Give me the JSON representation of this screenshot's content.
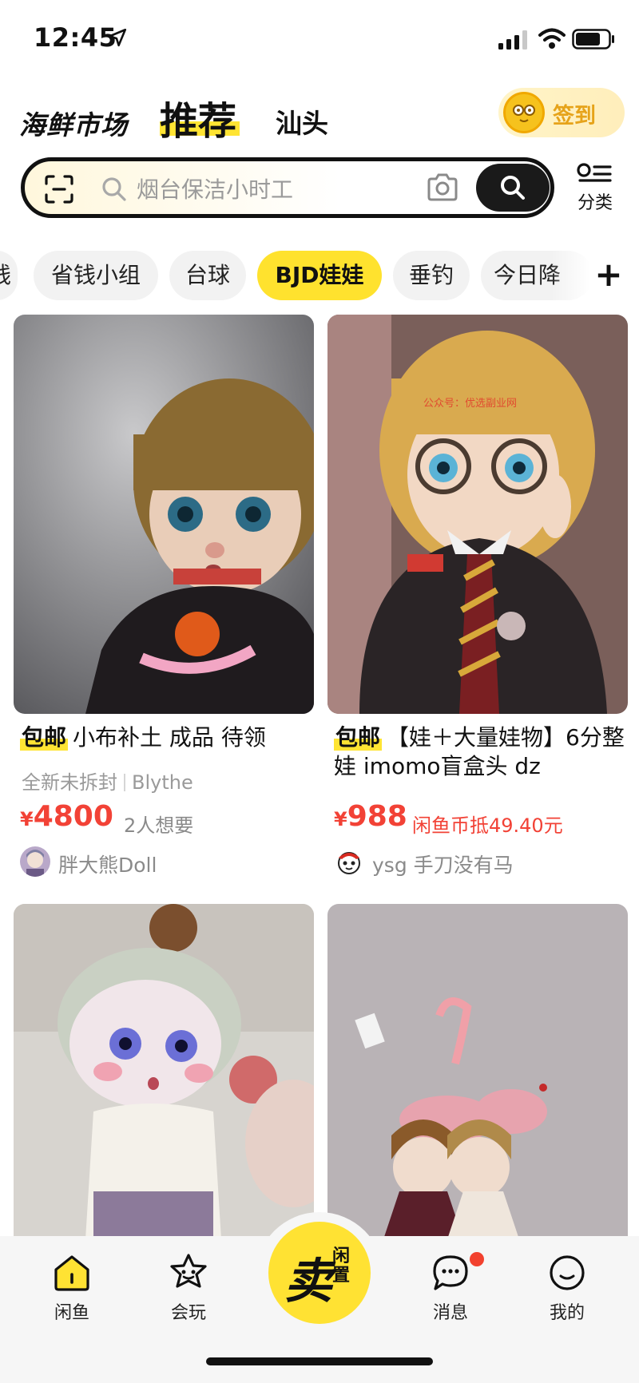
{
  "status_bar": {
    "time": "12:45"
  },
  "header": {
    "logo": "海鲜市场",
    "tab_active": "推荐",
    "tab_city": "汕头",
    "checkin_label": "签到"
  },
  "search": {
    "placeholder": "烟台保洁小时工",
    "category_label": "分类"
  },
  "chips": [
    {
      "label": "钱"
    },
    {
      "label": "省钱小组"
    },
    {
      "label": "台球"
    },
    {
      "label": "BJD娃娃",
      "active": true
    },
    {
      "label": "垂钓"
    },
    {
      "label": "今日降"
    }
  ],
  "chips_add": "+",
  "feed": [
    {
      "tag": "包邮",
      "title": "小布补土 成品 待领",
      "sub_condition": "全新未拆封",
      "sub_brand": "Blythe",
      "currency": "¥",
      "price": "4800",
      "extra": "2人想要",
      "seller": "胖大熊Doll"
    },
    {
      "tag": "包邮",
      "title": "【娃＋大量娃物】6分整娃 imomo盲盒头 dz",
      "currency": "¥",
      "price": "988",
      "extra": "闲鱼币抵49.40元",
      "seller": "ysg 手刀没有马",
      "watermark": "公众号：优选副业网"
    }
  ],
  "bottom_nav": {
    "items": [
      {
        "label": "闲鱼"
      },
      {
        "label": "会玩"
      },
      {
        "label": "消息"
      },
      {
        "label": "我的"
      }
    ],
    "sell_main": "卖",
    "sell_sub": "闲置"
  },
  "colors": {
    "accent": "#ffe233",
    "price": "#f24236",
    "dark": "#111111"
  },
  "icons": [
    "location-arrow-icon",
    "signal-icon",
    "wifi-icon",
    "battery-icon",
    "scan-icon",
    "search-icon",
    "camera-icon",
    "category-icon",
    "home-icon",
    "fun-icon",
    "message-icon",
    "profile-icon"
  ]
}
